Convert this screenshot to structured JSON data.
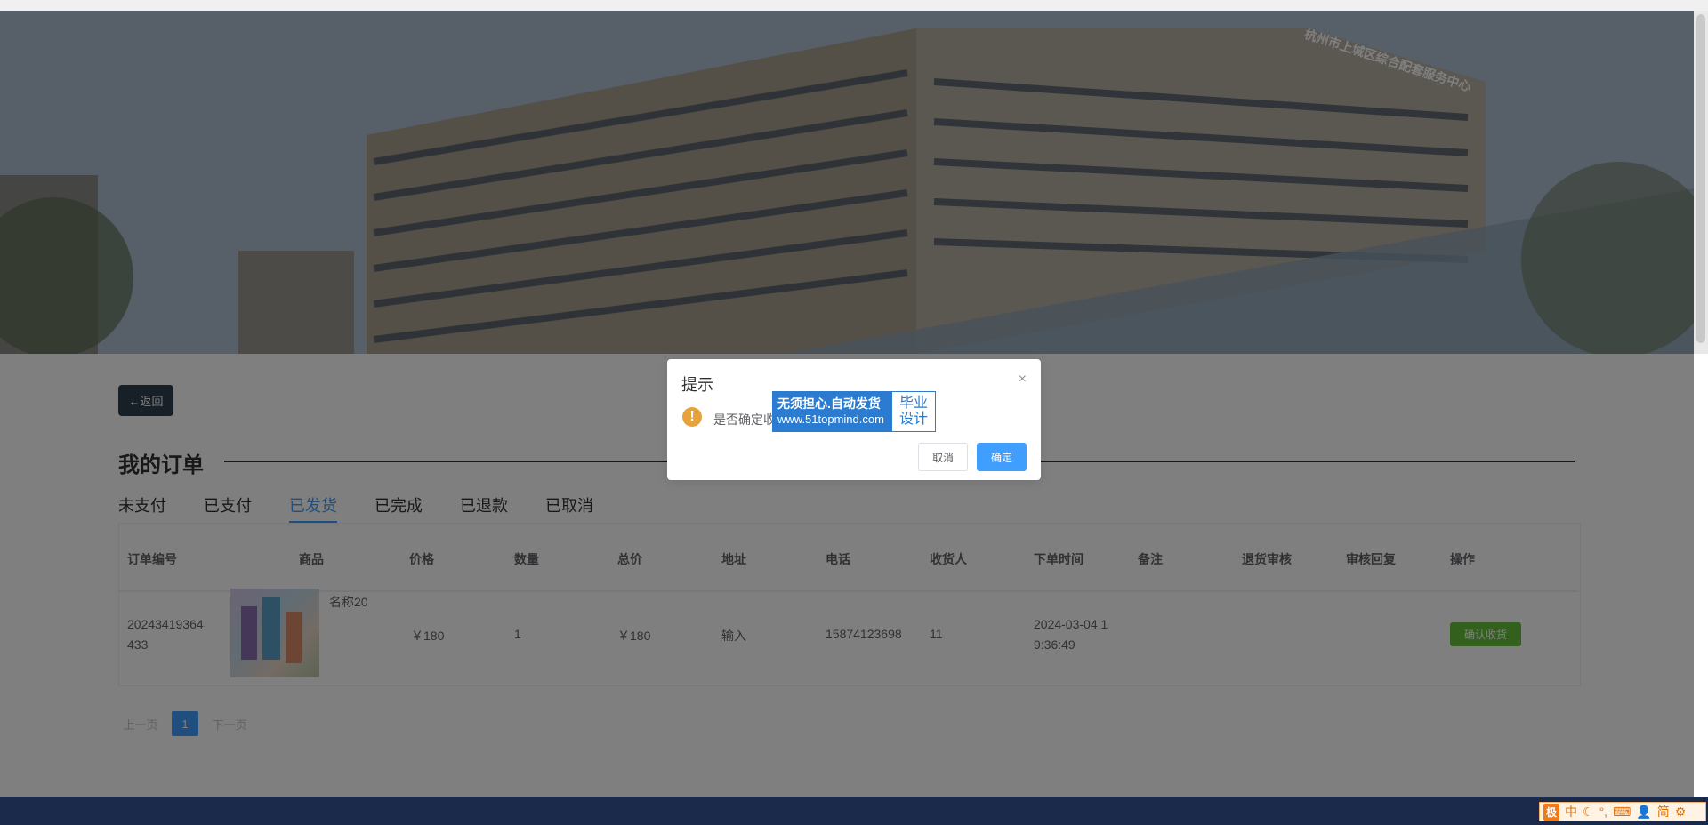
{
  "banner": {
    "sign_text": "杭州市上城区综合配套服务中心"
  },
  "nav": {
    "back_label": "←返回"
  },
  "orders": {
    "title": "我的订单",
    "tabs": [
      {
        "label": "未支付",
        "active": false
      },
      {
        "label": "已支付",
        "active": false
      },
      {
        "label": "已发货",
        "active": true
      },
      {
        "label": "已完成",
        "active": false
      },
      {
        "label": "已退款",
        "active": false
      },
      {
        "label": "已取消",
        "active": false
      }
    ],
    "columns": [
      "订单编号",
      "商品",
      "价格",
      "数量",
      "总价",
      "地址",
      "电话",
      "收货人",
      "下单时间",
      "备注",
      "退货审核",
      "审核回复",
      "操作"
    ],
    "rows": [
      {
        "order_no_1": "20243419364",
        "order_no_2": "433",
        "product_name": "名称20",
        "price": "￥180",
        "quantity": "1",
        "total": "￥180",
        "address": "输入",
        "phone": "15874123698",
        "receiver": "11",
        "time_1": "2024-03-04 1",
        "time_2": "9:36:49",
        "action_label": "确认收货"
      }
    ]
  },
  "pagination": {
    "prev": "上一页",
    "current": "1",
    "next": "下一页"
  },
  "dialog": {
    "title": "提示",
    "close": "×",
    "icon": "warning-icon",
    "message": "是否确定收",
    "cancel_label": "取消",
    "ok_label": "确定",
    "watermark_line1": "无须担心.自动发货",
    "watermark_line2": "www.51topmind.com",
    "watermark_right1": "毕业",
    "watermark_right2": "设计"
  },
  "ime_bar": {
    "logo": "极",
    "lang": "中",
    "mode": "简"
  },
  "colors": {
    "primary": "#409eff",
    "success": "#67c23a",
    "warning": "#e6a23c",
    "back_button": "#2f3e4f",
    "footer": "#1b2a4a"
  }
}
